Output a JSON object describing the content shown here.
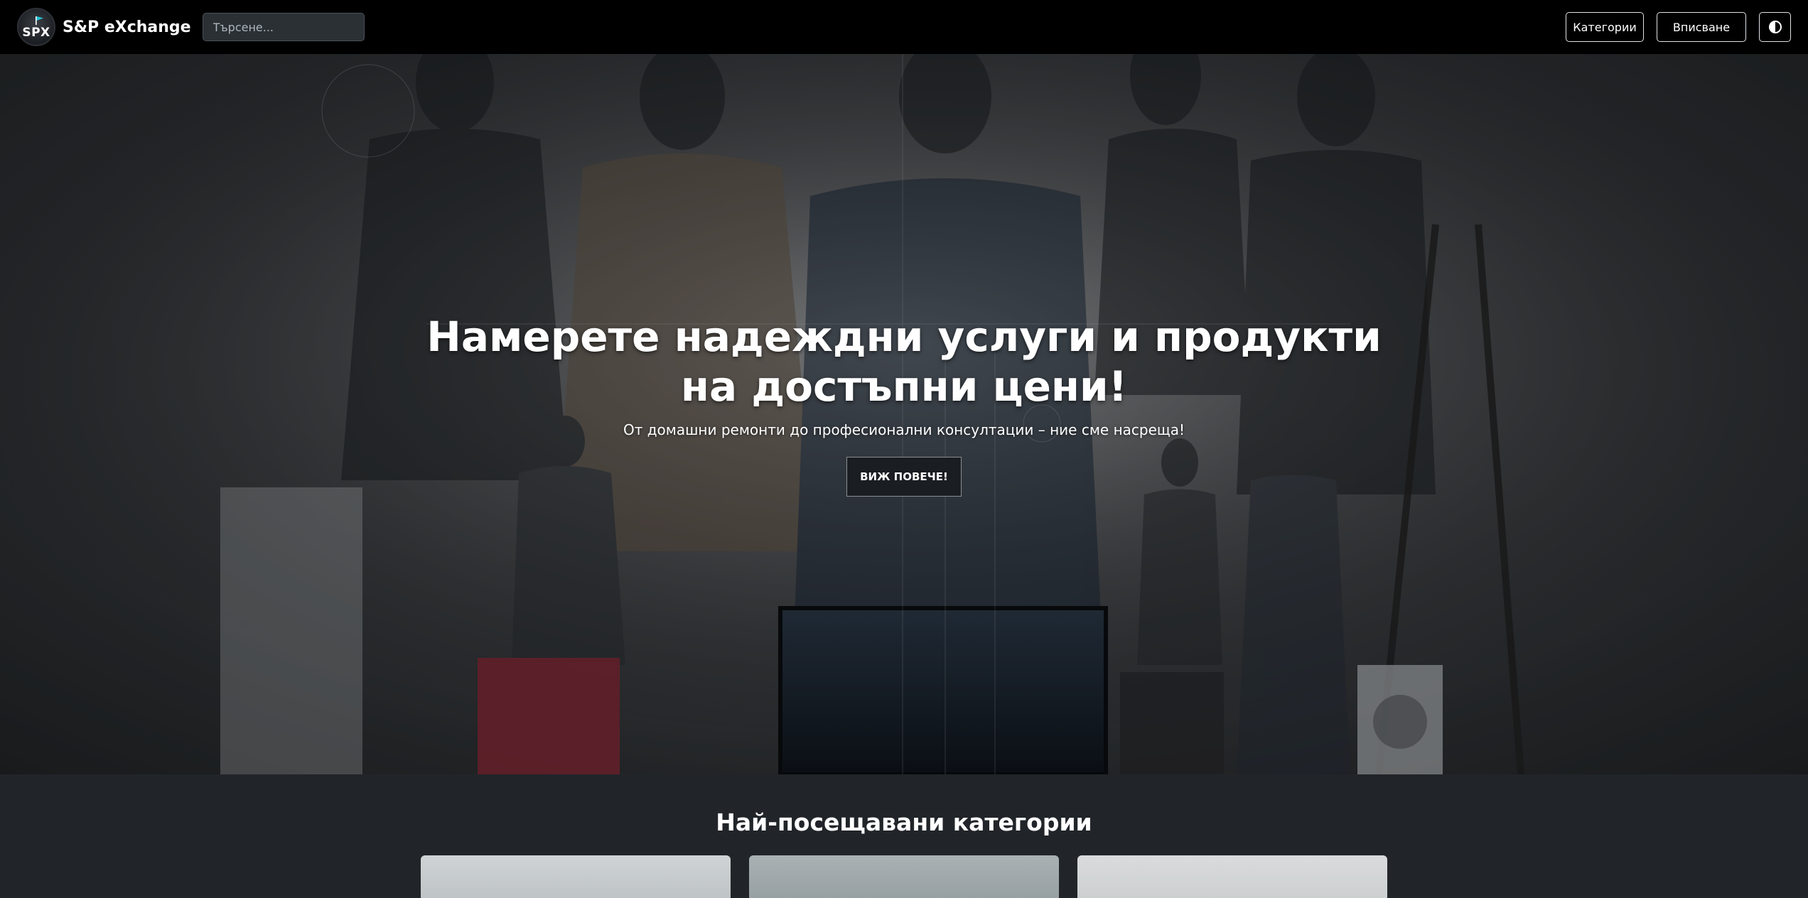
{
  "navbar": {
    "logo_text": "SPX",
    "brand": "S&P eXchange",
    "search_placeholder": "Търсене...",
    "categories_label": "Категории",
    "login_label": "Вписване",
    "theme_toggle_icon": "contrast-icon"
  },
  "hero": {
    "title": "Намерете надеждни услуги и продукти на достъпни цени!",
    "subtitle": "От домашни ремонти до професионални консултации – ние сме насреща!",
    "button_label": "ВИЖ ПОВЕЧЕ!"
  },
  "categories": {
    "title": "Най-посещавани категории"
  },
  "colors": {
    "navbar_bg": "#000000",
    "page_bg": "#212529",
    "logo_accent": "#20c4d8"
  }
}
